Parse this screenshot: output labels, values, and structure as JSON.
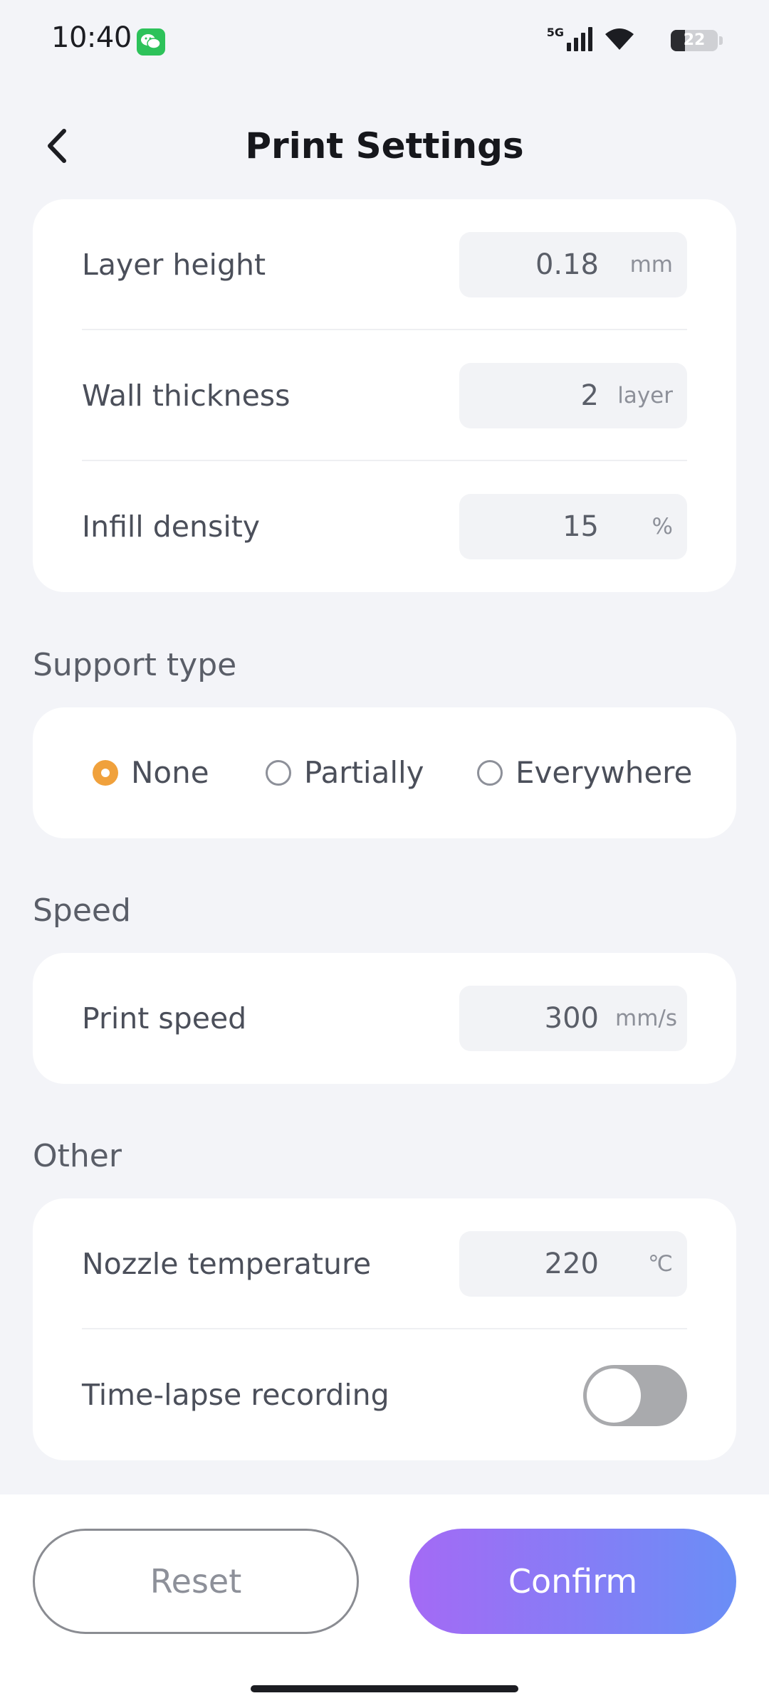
{
  "status_bar": {
    "time": "10:40",
    "network": "5G",
    "battery": "22"
  },
  "header": {
    "title": "Print Settings"
  },
  "basic": {
    "rows": [
      {
        "label": "Layer height",
        "value": "0.18",
        "unit": "mm"
      },
      {
        "label": "Wall thickness",
        "value": "2",
        "unit": "layer"
      },
      {
        "label": "Infill density",
        "value": "15",
        "unit": "%"
      }
    ]
  },
  "support": {
    "title": "Support type",
    "options": [
      {
        "label": "None",
        "selected": true
      },
      {
        "label": "Partially",
        "selected": false
      },
      {
        "label": "Everywhere",
        "selected": false
      }
    ]
  },
  "speed": {
    "title": "Speed",
    "print_speed": {
      "label": "Print speed",
      "value": "300",
      "unit": "mm/s"
    }
  },
  "other": {
    "title": "Other",
    "nozzle": {
      "label": "Nozzle temperature",
      "value": "220",
      "unit": "℃"
    },
    "timelapse": {
      "label": "Time-lapse recording",
      "enabled": false
    }
  },
  "footer": {
    "reset_label": "Reset",
    "confirm_label": "Confirm"
  },
  "colors": {
    "accent": "#f0a13c",
    "gradient_start": "#a46af5",
    "gradient_end": "#6a8ef6",
    "toggle_off": "#a9aaad"
  },
  "icons": {
    "back": "chevron-left-icon",
    "wechat": "wechat-icon",
    "signal": "signal-icon",
    "wifi": "wifi-icon",
    "battery": "battery-icon"
  }
}
